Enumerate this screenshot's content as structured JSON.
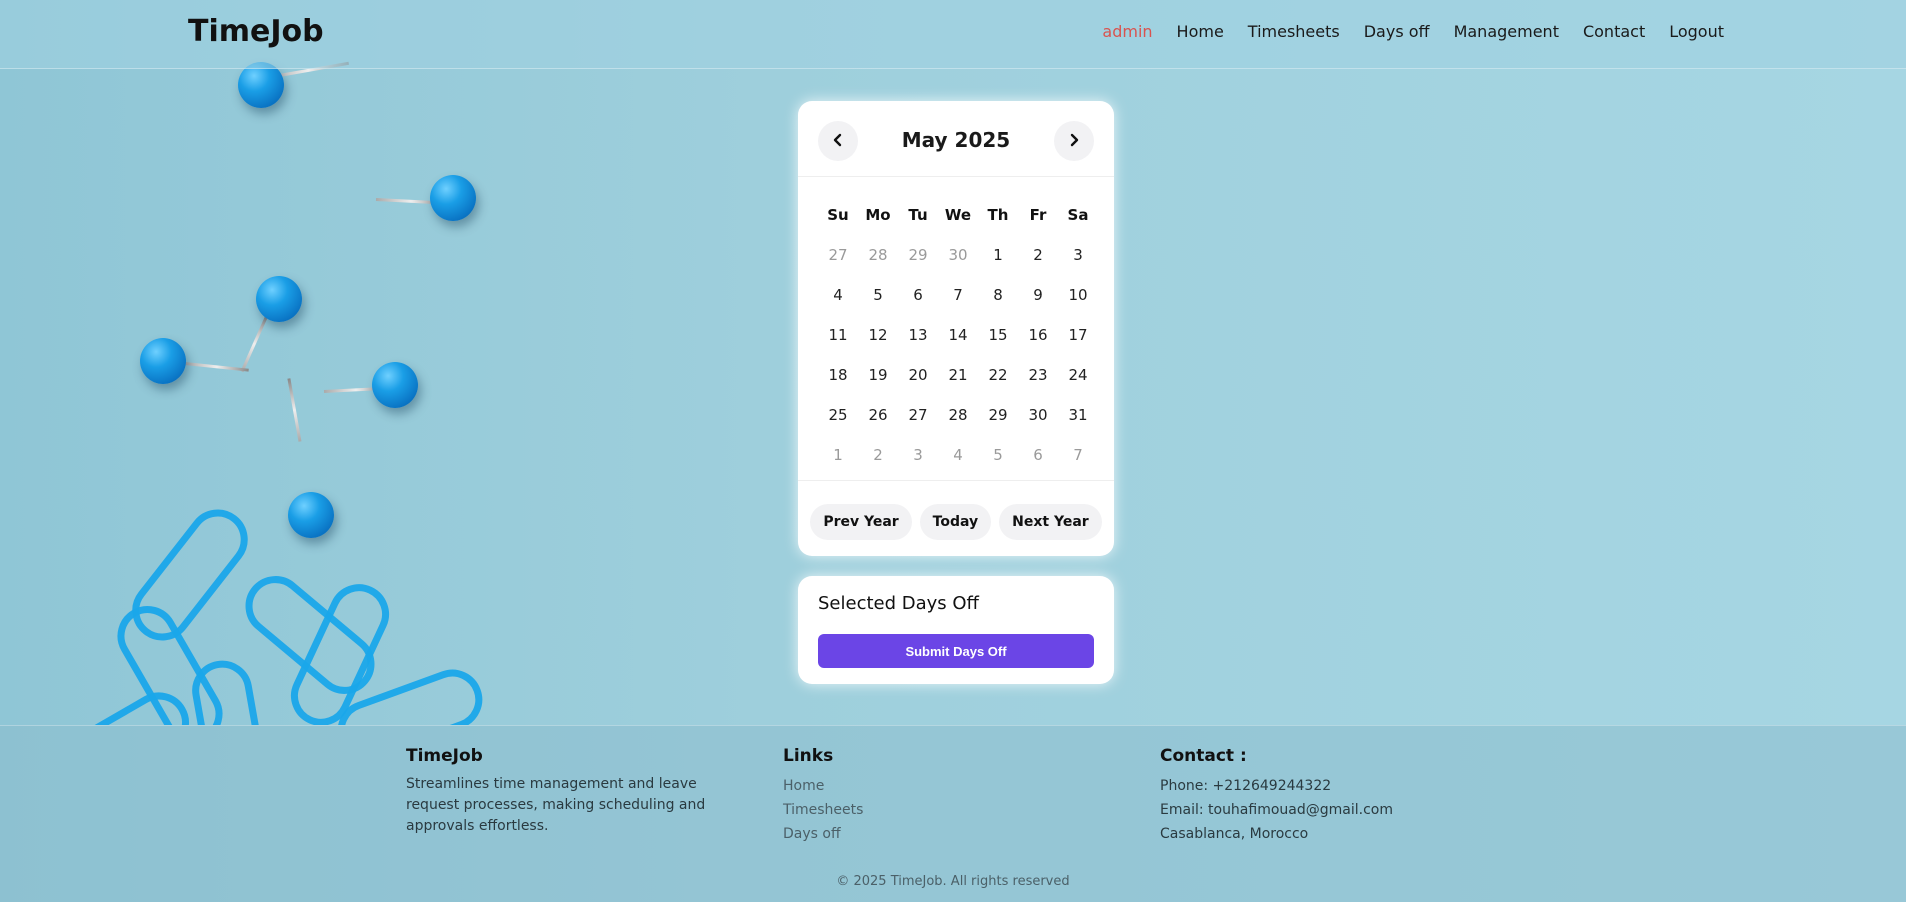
{
  "header": {
    "logo": "TimeJob",
    "nav": [
      "admin",
      "Home",
      "Timesheets",
      "Days off",
      "Management",
      "Contact",
      "Logout"
    ]
  },
  "calendar": {
    "month_title": "May 2025",
    "weekdays": [
      "Su",
      "Mo",
      "Tu",
      "We",
      "Th",
      "Fr",
      "Sa"
    ],
    "days": [
      {
        "d": "27",
        "other": true
      },
      {
        "d": "28",
        "other": true
      },
      {
        "d": "29",
        "other": true
      },
      {
        "d": "30",
        "other": true
      },
      {
        "d": "1"
      },
      {
        "d": "2"
      },
      {
        "d": "3"
      },
      {
        "d": "4"
      },
      {
        "d": "5"
      },
      {
        "d": "6"
      },
      {
        "d": "7"
      },
      {
        "d": "8"
      },
      {
        "d": "9"
      },
      {
        "d": "10"
      },
      {
        "d": "11"
      },
      {
        "d": "12"
      },
      {
        "d": "13"
      },
      {
        "d": "14"
      },
      {
        "d": "15"
      },
      {
        "d": "16"
      },
      {
        "d": "17"
      },
      {
        "d": "18"
      },
      {
        "d": "19"
      },
      {
        "d": "20"
      },
      {
        "d": "21"
      },
      {
        "d": "22"
      },
      {
        "d": "23"
      },
      {
        "d": "24"
      },
      {
        "d": "25"
      },
      {
        "d": "26"
      },
      {
        "d": "27"
      },
      {
        "d": "28"
      },
      {
        "d": "29"
      },
      {
        "d": "30"
      },
      {
        "d": "31"
      },
      {
        "d": "1",
        "other": true
      },
      {
        "d": "2",
        "other": true
      },
      {
        "d": "3",
        "other": true
      },
      {
        "d": "4",
        "other": true
      },
      {
        "d": "5",
        "other": true
      },
      {
        "d": "6",
        "other": true
      },
      {
        "d": "7",
        "other": true
      }
    ],
    "prev_year": "Prev Year",
    "today": "Today",
    "next_year": "Next Year",
    "prev_icon": "chevron-left-icon",
    "next_icon": "chevron-right-icon"
  },
  "selected": {
    "title": "Selected Days Off",
    "submit": "Submit Days Off"
  },
  "footer": {
    "about_title": "TimeJob",
    "about_text": "Streamlines time management and leave request processes, making scheduling and approvals effortless.",
    "links_title": "Links",
    "links": [
      "Home",
      "Timesheets",
      "Days off"
    ],
    "contact_title": "Contact :",
    "phone": "Phone: +212649244322",
    "email": "Email: touhafimouad@gmail.com",
    "location": "Casablanca, Morocco",
    "copyright": "© 2025 TimeJob. All rights reserved"
  },
  "colors": {
    "accent": "#6b45e6",
    "active_nav": "#d9534f",
    "background": "#9ecedc"
  }
}
